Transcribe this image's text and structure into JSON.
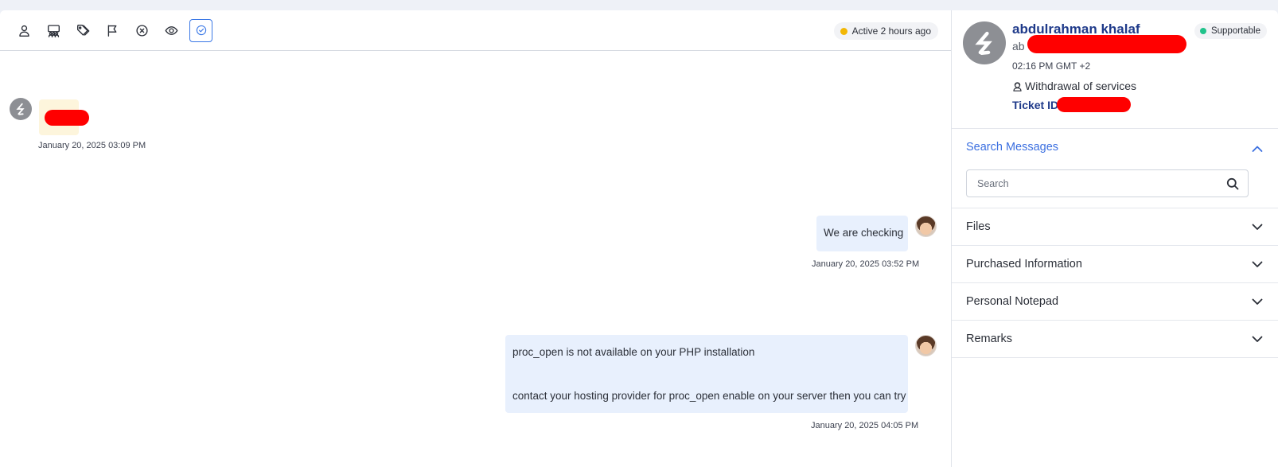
{
  "toolbar": {
    "tools": [
      {
        "icon": "user-icon"
      },
      {
        "icon": "group-icon"
      },
      {
        "icon": "tags-icon"
      },
      {
        "icon": "flag-icon"
      },
      {
        "icon": "close-circle-icon"
      },
      {
        "icon": "eye-icon"
      },
      {
        "icon": "check-circle-icon",
        "active": true
      }
    ],
    "presence": "Active 2 hours ago"
  },
  "messages": [
    {
      "direction": "incoming",
      "text": "",
      "time": "January 20, 2025 03:09 PM"
    },
    {
      "direction": "outgoing",
      "text": "We are checking",
      "time": "January 20, 2025 03:52 PM"
    },
    {
      "direction": "outgoing",
      "line1": "proc_open is not available on your PHP installation",
      "line2": "contact your hosting provider for proc_open enable on your server then you can try",
      "time": "January 20, 2025 04:05 PM"
    }
  ],
  "profile": {
    "name": "abdulrahman khalaf",
    "email_prefix": "ab",
    "local_time": "02:16 PM GMT +2",
    "service": "Withdrawal of services",
    "ticket_label": "Ticket ID",
    "status": "Supportable"
  },
  "search_section": {
    "title": "Search Messages",
    "placeholder": "Search"
  },
  "sections": [
    {
      "label": "Files"
    },
    {
      "label": "Purchased Information"
    },
    {
      "label": "Personal Notepad"
    },
    {
      "label": "Remarks"
    }
  ],
  "colors": {
    "accent": "#3b6fe0",
    "name": "#1f3a8a",
    "presence_dot": "#f2b705",
    "status_dot": "#20c38b",
    "redaction": "#ff0000"
  }
}
